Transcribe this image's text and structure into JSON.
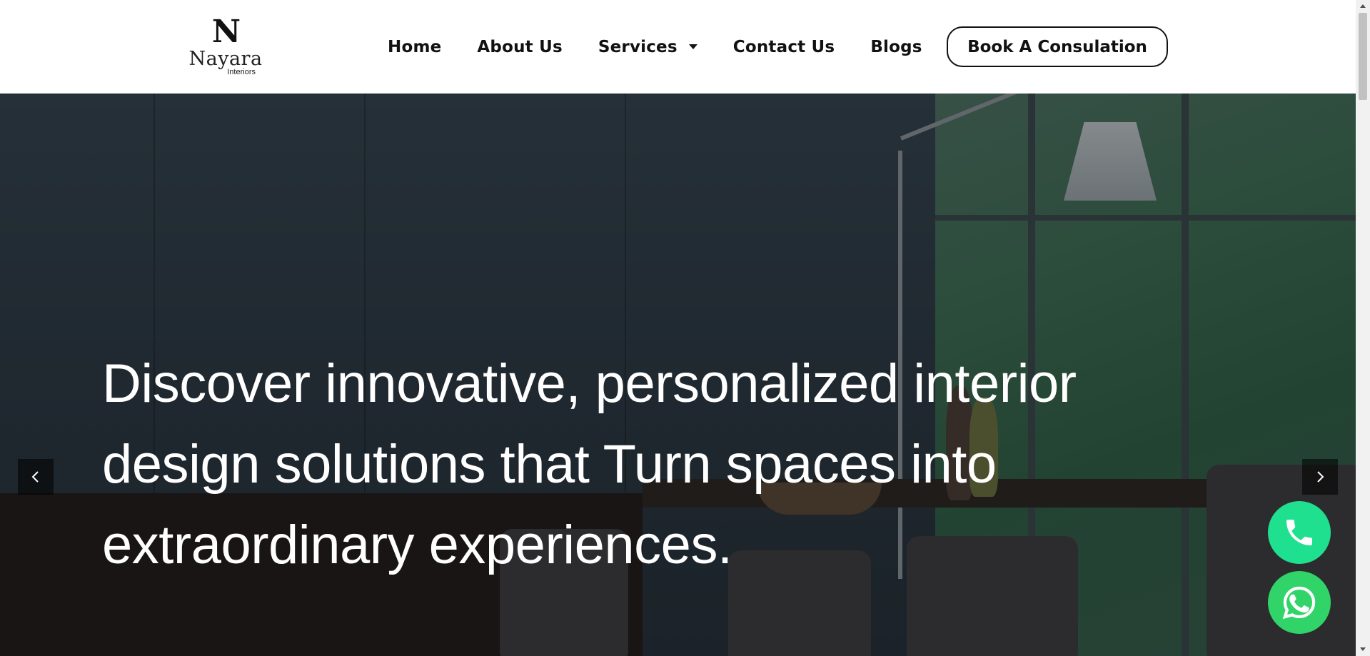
{
  "brand": {
    "logo_mark": "N",
    "logo_name": "Nayara",
    "logo_sub": "Interiors"
  },
  "nav": {
    "items": [
      {
        "label": "Home"
      },
      {
        "label": "About Us"
      },
      {
        "label": "Services",
        "has_dropdown": true
      },
      {
        "label": "Contact Us"
      },
      {
        "label": "Blogs"
      }
    ],
    "cta_label": "Book A Consulation"
  },
  "hero": {
    "headline": "Discover innovative, personalized interior design solutions that Turn spaces into extraordinary experiences.",
    "prev_icon": "chevron-left-icon",
    "next_icon": "chevron-right-icon"
  },
  "floating": {
    "phone_icon": "phone-icon",
    "whatsapp_icon": "whatsapp-icon"
  },
  "colors": {
    "phone_button": "#1ee08f",
    "whatsapp_button": "#31d468",
    "text_dark": "#111111"
  }
}
